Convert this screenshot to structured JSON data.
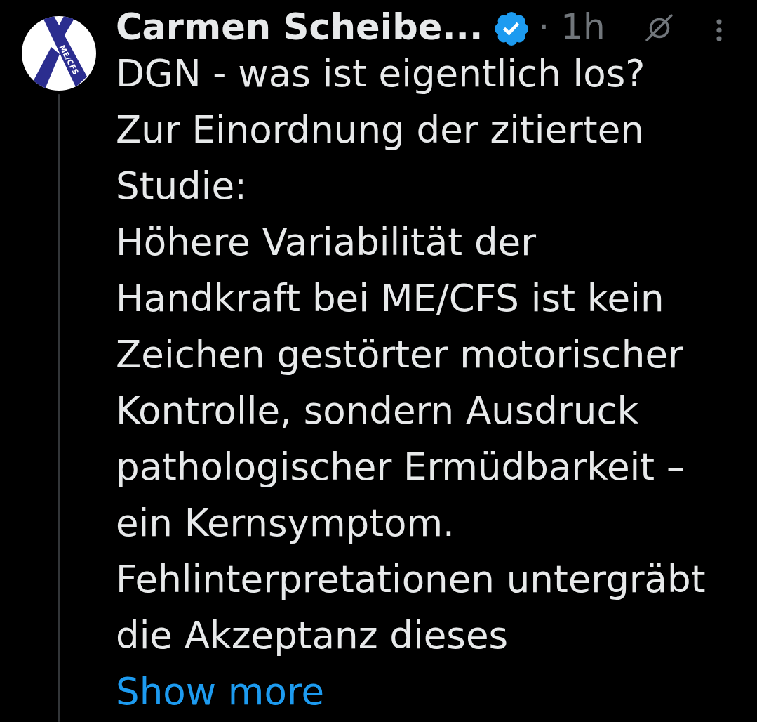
{
  "post": {
    "avatar": {
      "ribbon_text": "ME/CFS"
    },
    "thread_line": true,
    "author": {
      "name": "Carmen Scheibe...",
      "verified": true
    },
    "time": "· 1h",
    "body": [
      {
        "lines": [
          "DGN - was ist eigentlich los?"
        ]
      },
      {
        "lines": [
          "Zur Einordnung der zitierten",
          "Studie:"
        ]
      },
      {
        "lines": [
          "Höhere Variabilität der",
          "Handkraft bei ME/CFS ist kein",
          "Zeichen gestörter motorischer",
          "Kontrolle, sondern Ausdruck",
          "pathologischer Ermüdbarkeit –",
          "ein Kernsymptom."
        ]
      },
      {
        "lines": [
          "Fehlinterpretationen untergräbt",
          "die Akzeptanz dieses"
        ]
      }
    ],
    "show_more": "Show more"
  }
}
